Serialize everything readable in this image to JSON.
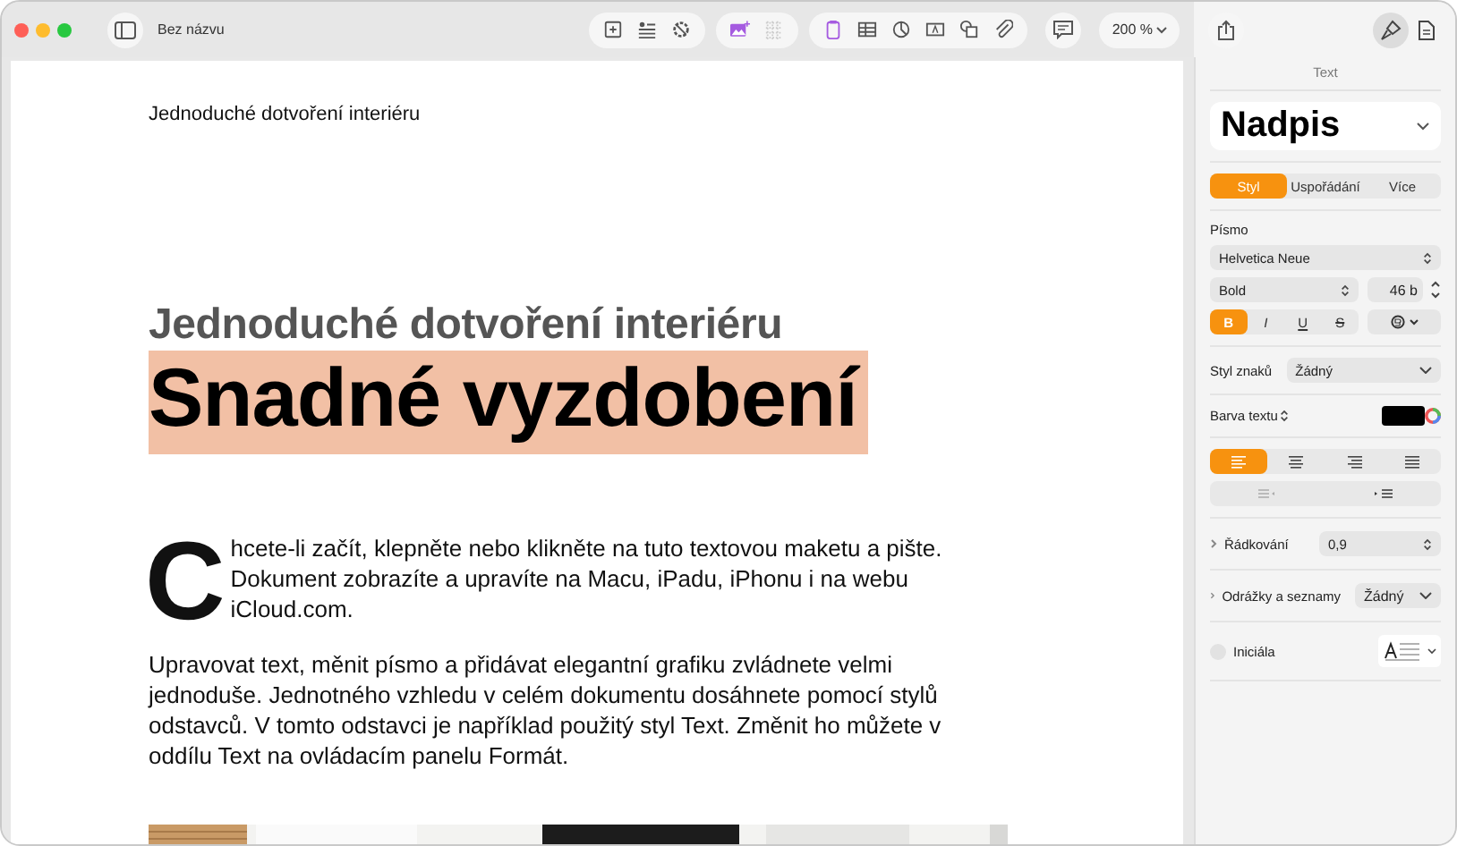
{
  "window": {
    "title": "Bez názvu"
  },
  "toolbar": {
    "zoom": "200 %",
    "inspector": [
      {
        "kind": "format",
        "selected": true
      },
      {
        "kind": "document",
        "selected": false
      }
    ]
  },
  "document": {
    "header": "Jednoduché dotvoření interiéru",
    "subtitle": "Jednoduché dotvoření interiéru",
    "title": "Snadné vyzdobení",
    "drop_cap": "C",
    "paragraphs": [
      "hcete-li začít, klepněte nebo klikněte na tuto textovou maketu a pište. Dokument zobrazíte a upravíte na Macu, iPadu, iPhonu i na webu iCloud.com.",
      "Upravovat text, měnit písmo a přidávat elegantní grafiku zvládnete velmi jednoduše. Jednotného vzhledu v celém dokumentu dosáhnete pomocí stylů odstavců. V tomto odstavci je například použitý styl Text. Změnit ho můžete v oddílu Text na ovládacím panelu Formát."
    ],
    "picture": {
      "kind": "picture"
    }
  },
  "sidebar": {
    "heading": "Text",
    "paragraph_style": "Nadpis",
    "tabs": [
      {
        "label": "Styl",
        "selected": true
      },
      {
        "label": "Uspořádání",
        "selected": false
      },
      {
        "label": "Více",
        "selected": false
      }
    ],
    "font_label": "Písmo",
    "font": "Helvetica Neue",
    "weight": "Bold",
    "size": "46 b",
    "format_buttons": [
      {
        "label": "B",
        "selected": true,
        "kind": "bold"
      },
      {
        "label": "I",
        "selected": false,
        "kind": "italic"
      },
      {
        "label": "U",
        "selected": false,
        "kind": "underline"
      },
      {
        "label": "S",
        "selected": false,
        "kind": "strike"
      }
    ],
    "char_style_label": "Styl znaků",
    "char_style": "Žádný",
    "text_color_label": "Barva textu",
    "alignment": [
      {
        "kind": "left",
        "selected": true
      },
      {
        "kind": "center",
        "selected": false
      },
      {
        "kind": "right",
        "selected": false
      },
      {
        "kind": "justify",
        "selected": false
      }
    ],
    "line_spacing_label": "Řádkování",
    "line_spacing": "0,9",
    "bullets_label": "Odrážky a seznamy",
    "bullets": "Žádný",
    "drop_cap_label": "Iniciála",
    "drop_cap_checked": false
  }
}
